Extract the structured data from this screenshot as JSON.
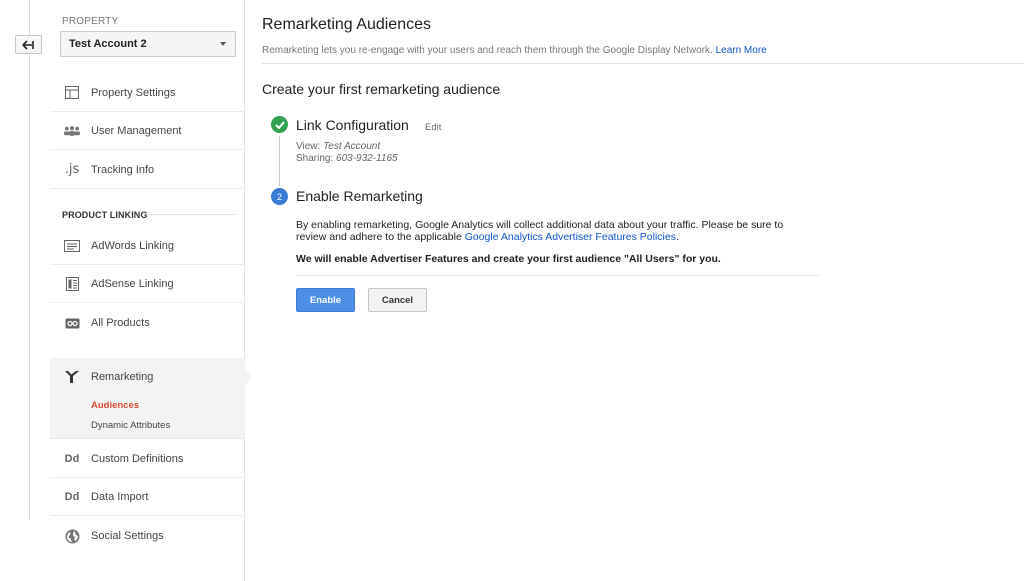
{
  "sidebar": {
    "property_label": "PROPERTY",
    "property_value": "Test Account 2",
    "items_top": [
      {
        "label": "Property Settings",
        "icon": "window-icon"
      },
      {
        "label": "User Management",
        "icon": "users-icon"
      },
      {
        "label": "Tracking Info",
        "icon": "js-icon"
      }
    ],
    "section_header": "PRODUCT LINKING",
    "items_linking": [
      {
        "label": "AdWords Linking",
        "icon": "adwords-icon"
      },
      {
        "label": "AdSense Linking",
        "icon": "adsense-icon"
      },
      {
        "label": "All Products",
        "icon": "link-icon"
      }
    ],
    "remarketing": {
      "label": "Remarketing",
      "icon": "fork-icon",
      "sub_items": [
        "Audiences",
        "Dynamic Attributes"
      ],
      "active_sub": "Audiences"
    },
    "items_bottom": [
      {
        "label": "Custom Definitions",
        "icon": "dd-icon",
        "glyph": "Dd"
      },
      {
        "label": "Data Import",
        "icon": "dd-icon",
        "glyph": "Dd"
      },
      {
        "label": "Social Settings",
        "icon": "globe-icon"
      }
    ]
  },
  "main": {
    "title": "Remarketing Audiences",
    "description": "Remarketing lets you re-engage with your users and reach them through the Google Display Network.",
    "learn_more": "Learn More",
    "create_title": "Create your first remarketing audience",
    "step1": {
      "title": "Link Configuration",
      "edit": "Edit",
      "view_label": "View:",
      "view_value": "Test Account",
      "sharing_label": "Sharing:",
      "sharing_value": "603-932-1165"
    },
    "step2": {
      "number": "2",
      "title": "Enable Remarketing",
      "body": "By enabling remarketing, Google Analytics will collect additional data about your traffic. Please be sure to review and adhere to the applicable",
      "policy_link": "Google Analytics Advertiser Features Policies",
      "period": ".",
      "bold_note": "We will enable Advertiser Features and create your first audience \"All Users\" for you."
    },
    "buttons": {
      "enable": "Enable",
      "cancel": "Cancel"
    }
  },
  "colors": {
    "accent_blue": "#4d8fe7",
    "link_blue": "#1155cc",
    "active_red": "#dd4b39",
    "success_green": "#2fa14f"
  }
}
